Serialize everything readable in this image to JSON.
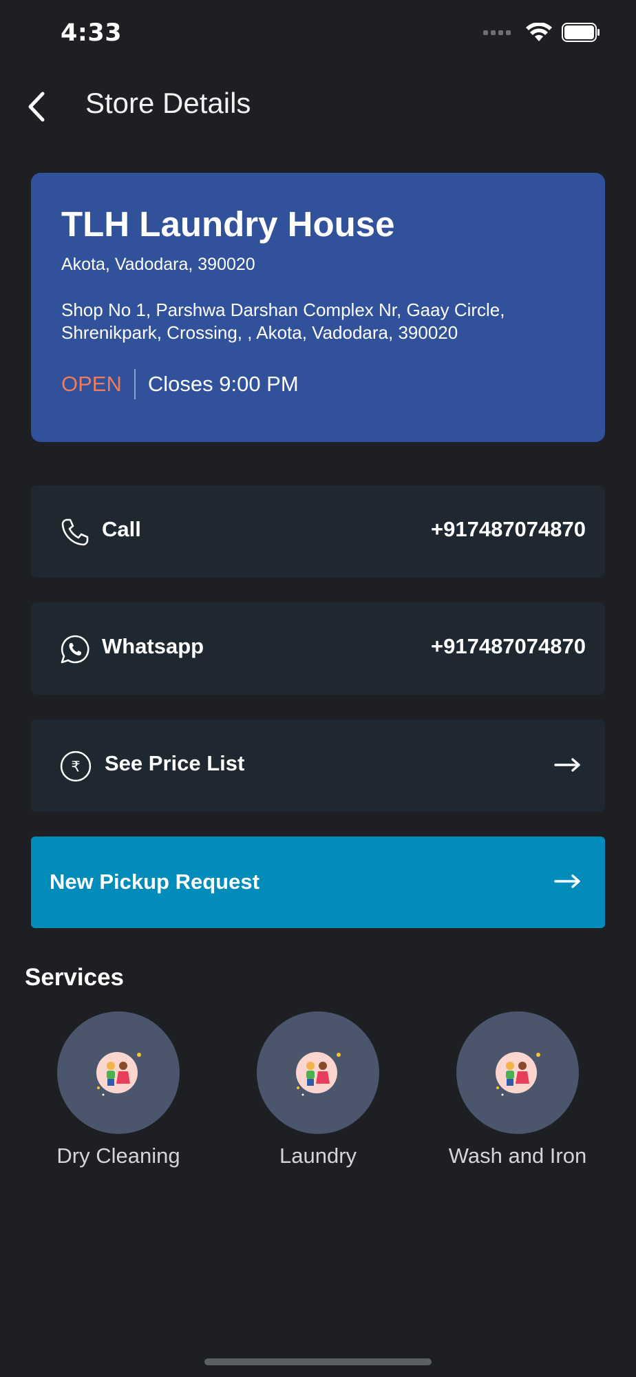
{
  "status_bar": {
    "time": "4:33"
  },
  "nav": {
    "title": "Store Details",
    "back_icon": "chevron-left-icon"
  },
  "store": {
    "name": "TLH Laundry House",
    "locality": "Akota, Vadodara, 390020",
    "address": "Shop No 1, Parshwa Darshan Complex Nr, Gaay Circle, Shrenikpark, Crossing, , Akota, Vadodara, 390020",
    "status": "OPEN",
    "closes": "Closes 9:00 PM",
    "status_color": "#ef7b5c",
    "card_color": "#32519b"
  },
  "actions": {
    "call": {
      "label": "Call",
      "value": "+917487074870",
      "icon": "phone-icon"
    },
    "whatsapp": {
      "label": "Whatsapp",
      "value": "+917487074870",
      "icon": "whatsapp-icon"
    },
    "price_list": {
      "label": "See Price List",
      "icon": "rupee-icon"
    }
  },
  "pickup": {
    "label": "New Pickup Request",
    "color": "#018cb9"
  },
  "services": {
    "title": "Services",
    "items": [
      {
        "label": "Dry Cleaning"
      },
      {
        "label": "Laundry"
      },
      {
        "label": "Wash and Iron"
      }
    ]
  }
}
